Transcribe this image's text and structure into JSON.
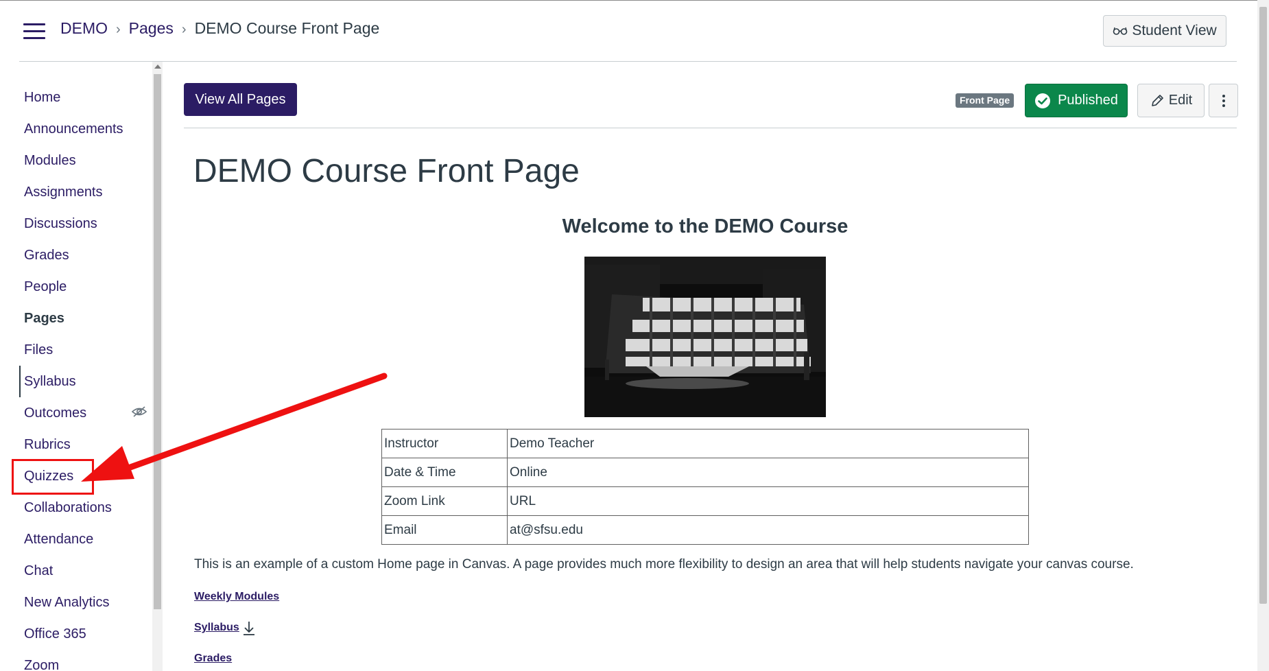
{
  "header": {
    "breadcrumb": {
      "course": "DEMO",
      "section": "Pages",
      "current": "DEMO Course Front Page"
    },
    "student_view_label": "Student View"
  },
  "sidebar": {
    "items": [
      {
        "label": "Home"
      },
      {
        "label": "Announcements"
      },
      {
        "label": "Modules"
      },
      {
        "label": "Assignments"
      },
      {
        "label": "Discussions"
      },
      {
        "label": "Grades"
      },
      {
        "label": "People"
      },
      {
        "label": "Pages",
        "active": true
      },
      {
        "label": "Files"
      },
      {
        "label": "Syllabus"
      },
      {
        "label": "Outcomes",
        "hidden_icon": "eye-off-icon"
      },
      {
        "label": "Rubrics"
      },
      {
        "label": "Quizzes",
        "highlighted": true
      },
      {
        "label": "Collaborations"
      },
      {
        "label": "Attendance"
      },
      {
        "label": "Chat"
      },
      {
        "label": "New Analytics"
      },
      {
        "label": "Office 365"
      },
      {
        "label": "Zoom"
      }
    ]
  },
  "toolbar": {
    "view_all_label": "View All Pages",
    "front_page_badge": "Front Page",
    "published_label": "Published",
    "edit_label": "Edit",
    "more_icon": "more-vertical-icon"
  },
  "page": {
    "title": "DEMO Course Front Page",
    "welcome_heading": "Welcome to the DEMO Course",
    "info_rows": [
      {
        "key": "Instructor",
        "value": "Demo Teacher"
      },
      {
        "key": "Date & Time",
        "value": "Online"
      },
      {
        "key": "Zoom Link",
        "value": "URL"
      },
      {
        "key": "Email",
        "value": "at@sfsu.edu"
      }
    ],
    "description": "This is an example of a custom Home page in Canvas. A page provides much more flexibility to design an area that will help students navigate your canvas course.",
    "links": [
      {
        "label": "Weekly Modules"
      },
      {
        "label": "Syllabus",
        "icon": "download-icon"
      },
      {
        "label": "Grades"
      }
    ]
  },
  "colors": {
    "brand": "#2b1c64",
    "published": "#0b874b",
    "annotation": "#ee1111"
  }
}
